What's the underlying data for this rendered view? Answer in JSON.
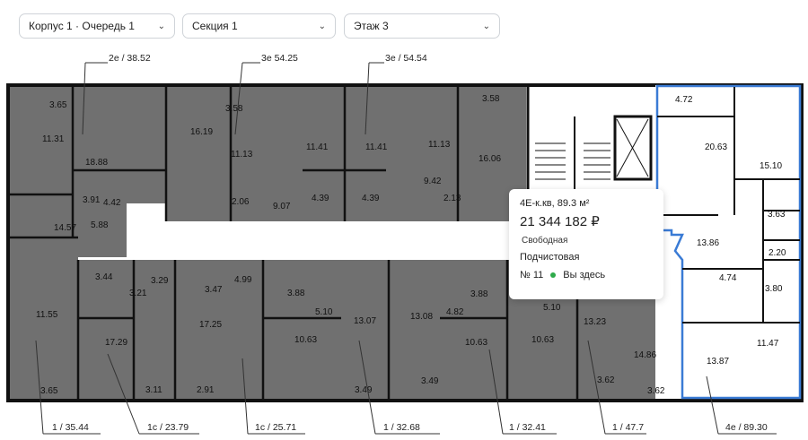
{
  "filters": {
    "building": "Корпус 1 · Очередь 1",
    "section": "Секция 1",
    "floor": "Этаж 3"
  },
  "colors": {
    "unit_fill": "#707070",
    "selected_outline": "#3a7bd5",
    "status_dot": "#2eaa4a"
  },
  "top_tags": [
    "2е / 38.52",
    "3е  54.25",
    "3е / 54.54"
  ],
  "bottom_tags": [
    "1  /  35.44",
    "1с  /  23.79",
    "1с  /  25.71",
    "1  /  32.68",
    "1  /  32.41",
    "1  /  47.7",
    "4е  /  89.30"
  ],
  "room_areas": [
    "3.65",
    "11.31",
    "18.88",
    "3.91",
    "4.42",
    "14.57",
    "5.88",
    "3.58",
    "16.19",
    "11.13",
    "2.06",
    "9.07",
    "11.41",
    "4.39",
    "11.41",
    "4.39",
    "11.13",
    "9.42",
    "2.13",
    "3.58",
    "16.06",
    "4.72",
    "20.63",
    "15.10",
    "3.63",
    "2.20",
    "13.86",
    "4.74",
    "3.80",
    "11.47",
    "13.87",
    "3.44",
    "3.21",
    "3.29",
    "3.47",
    "4.99",
    "3.88",
    "5.10",
    "13.07",
    "13.08",
    "4.82",
    "3.88",
    "5.10",
    "11.55",
    "17.29",
    "17.25",
    "10.63",
    "10.63",
    "10.63",
    "13.23",
    "14.86",
    "3.65",
    "3.11",
    "2.91",
    "3.49",
    "3.49",
    "3.62",
    "3.62"
  ],
  "popup": {
    "type": "4Е-к.кв, 89.3 м²",
    "price": "21 344 182 ₽",
    "status": "Свободная",
    "finish": "Подчистовая",
    "number": "№ 11",
    "here": "Вы здесь"
  }
}
